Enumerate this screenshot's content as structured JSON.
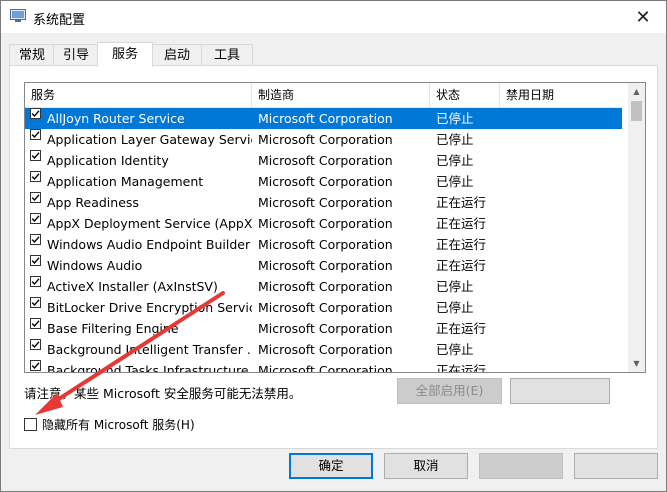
{
  "window": {
    "title": "系统配置",
    "close_glyph": "✕"
  },
  "tabs": [
    {
      "label": "常规"
    },
    {
      "label": "引导"
    },
    {
      "label": "服务"
    },
    {
      "label": "启动"
    },
    {
      "label": "工具"
    }
  ],
  "active_tab": "服务",
  "columns": {
    "service": "服务",
    "vendor": "制造商",
    "status": "状态",
    "disabled_date": "禁用日期"
  },
  "services": [
    {
      "name": "AllJoyn Router Service",
      "vendor": "Microsoft Corporation",
      "status": "已停止",
      "checked": true,
      "selected": true
    },
    {
      "name": "Application Layer Gateway Service",
      "vendor": "Microsoft Corporation",
      "status": "已停止",
      "checked": true
    },
    {
      "name": "Application Identity",
      "vendor": "Microsoft Corporation",
      "status": "已停止",
      "checked": true
    },
    {
      "name": "Application Management",
      "vendor": "Microsoft Corporation",
      "status": "已停止",
      "checked": true
    },
    {
      "name": "App Readiness",
      "vendor": "Microsoft Corporation",
      "status": "正在运行",
      "checked": true
    },
    {
      "name": "AppX Deployment Service (AppX...",
      "vendor": "Microsoft Corporation",
      "status": "正在运行",
      "checked": true
    },
    {
      "name": "Windows Audio Endpoint Builder",
      "vendor": "Microsoft Corporation",
      "status": "正在运行",
      "checked": true
    },
    {
      "name": "Windows Audio",
      "vendor": "Microsoft Corporation",
      "status": "正在运行",
      "checked": true
    },
    {
      "name": "ActiveX Installer (AxInstSV)",
      "vendor": "Microsoft Corporation",
      "status": "已停止",
      "checked": true
    },
    {
      "name": "BitLocker Drive Encryption Service",
      "vendor": "Microsoft Corporation",
      "status": "已停止",
      "checked": true
    },
    {
      "name": "Base Filtering Engine",
      "vendor": "Microsoft Corporation",
      "status": "正在运行",
      "checked": true
    },
    {
      "name": "Background Intelligent Transfer ...",
      "vendor": "Microsoft Corporation",
      "status": "已停止",
      "checked": true
    },
    {
      "name": "Background Tasks Infrastructure ...",
      "vendor": "Microsoft Corporation",
      "status": "正在运行",
      "checked": true
    }
  ],
  "note": "请注意，某些 Microsoft 安全服务可能无法禁用。",
  "buttons": {
    "enable_all": "全部启用(E)",
    "ok": "确定",
    "cancel": "取消"
  },
  "hide_ms": {
    "label": "隐藏所有 Microsoft 服务(H)",
    "checked": false
  },
  "colors": {
    "selection": "#0078d7",
    "annotation_arrow": "#e53935"
  }
}
